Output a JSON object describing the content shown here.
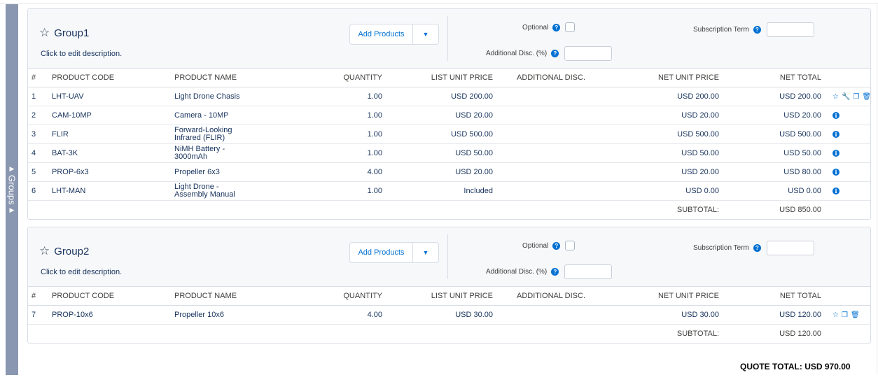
{
  "rail": {
    "label": "Groups"
  },
  "group_labels": {
    "add_products": "Add Products",
    "optional": "Optional",
    "additional_disc": "Additional Disc. (%)",
    "subscription_term": "Subscription Term",
    "description": "Click to edit description.",
    "subtotal": "SUBTOTAL:"
  },
  "columns": [
    "#",
    "PRODUCT CODE",
    "PRODUCT NAME",
    "QUANTITY",
    "LIST UNIT PRICE",
    "ADDITIONAL DISC.",
    "NET UNIT PRICE",
    "NET TOTAL"
  ],
  "groups": [
    {
      "name": "Group1",
      "subtotal": "USD 850.00",
      "rows": [
        {
          "n": "1",
          "code": "LHT-UAV",
          "name": "Light Drone Chasis",
          "qty": "1.00",
          "list": "USD 200.00",
          "disc": "",
          "net": "USD 200.00",
          "total": "USD 200.00",
          "icons": [
            "star-icon",
            "wrench-icon",
            "clone-icon",
            "trash-icon"
          ]
        },
        {
          "n": "2",
          "code": "CAM-10MP",
          "name": "Camera - 10MP",
          "qty": "1.00",
          "list": "USD 20.00",
          "disc": "",
          "net": "USD 20.00",
          "total": "USD 20.00",
          "icons": [
            "info-icon"
          ]
        },
        {
          "n": "3",
          "code": "FLIR",
          "name": "Forward-Looking Infrared (FLIR)",
          "qty": "1.00",
          "list": "USD 500.00",
          "disc": "",
          "net": "USD 500.00",
          "total": "USD 500.00",
          "icons": [
            "info-icon"
          ]
        },
        {
          "n": "4",
          "code": "BAT-3K",
          "name": "NiMH Battery - 3000mAh",
          "qty": "1.00",
          "list": "USD 50.00",
          "disc": "",
          "net": "USD 50.00",
          "total": "USD 50.00",
          "icons": [
            "info-icon"
          ]
        },
        {
          "n": "5",
          "code": "PROP-6x3",
          "name": "Propeller 6x3",
          "qty": "4.00",
          "list": "USD 20.00",
          "disc": "",
          "net": "USD 20.00",
          "total": "USD 80.00",
          "icons": [
            "info-icon"
          ]
        },
        {
          "n": "6",
          "code": "LHT-MAN",
          "name": "Light Drone - Assembly Manual",
          "qty": "1.00",
          "list": "Included",
          "disc": "",
          "net": "USD 0.00",
          "total": "USD 0.00",
          "icons": [
            "info-icon"
          ]
        }
      ]
    },
    {
      "name": "Group2",
      "subtotal": "USD 120.00",
      "rows": [
        {
          "n": "7",
          "code": "PROP-10x6",
          "name": "Propeller 10x6",
          "qty": "4.00",
          "list": "USD 30.00",
          "disc": "",
          "net": "USD 30.00",
          "total": "USD 120.00",
          "icons": [
            "star-icon",
            "clone-icon",
            "trash-icon"
          ]
        }
      ]
    }
  ],
  "quote_total": "QUOTE TOTAL: USD 970.00"
}
